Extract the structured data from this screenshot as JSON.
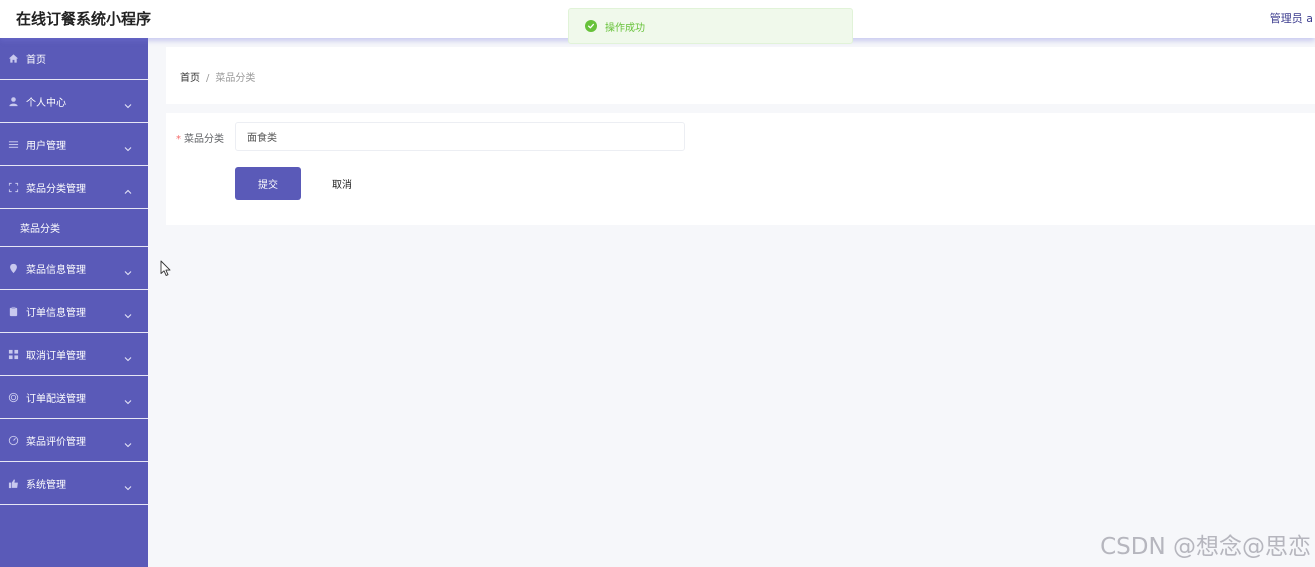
{
  "app": {
    "title": "在线订餐系统小程序",
    "user": "管理员 a"
  },
  "toast": {
    "message": "操作成功",
    "status_color": "#67c23a"
  },
  "theme": {
    "sidebar_bg": "#5a5ab8",
    "primary": "#5a5ab8"
  },
  "sidebar": {
    "items": [
      {
        "label": "首页",
        "icon": "home-icon"
      },
      {
        "label": "个人中心",
        "icon": "user-icon"
      },
      {
        "label": "用户管理",
        "icon": "list-icon"
      },
      {
        "label": "菜品分类管理",
        "icon": "frame-icon",
        "expanded": true,
        "children": [
          {
            "label": "菜品分类"
          }
        ]
      },
      {
        "label": "菜品信息管理",
        "icon": "location-icon"
      },
      {
        "label": "订单信息管理",
        "icon": "clipboard-icon"
      },
      {
        "label": "取消订单管理",
        "icon": "grid-icon"
      },
      {
        "label": "订单配送管理",
        "icon": "circle-icon"
      },
      {
        "label": "菜品评价管理",
        "icon": "gauge-icon"
      },
      {
        "label": "系统管理",
        "icon": "thumb-icon"
      }
    ]
  },
  "breadcrumb": {
    "home": "首页",
    "separator": "/",
    "current": "菜品分类"
  },
  "form": {
    "required_mark": "*",
    "field_label": "菜品分类",
    "field_value": "面食类",
    "submit_label": "提交",
    "cancel_label": "取消"
  },
  "watermark": "CSDN @想念@思恋"
}
